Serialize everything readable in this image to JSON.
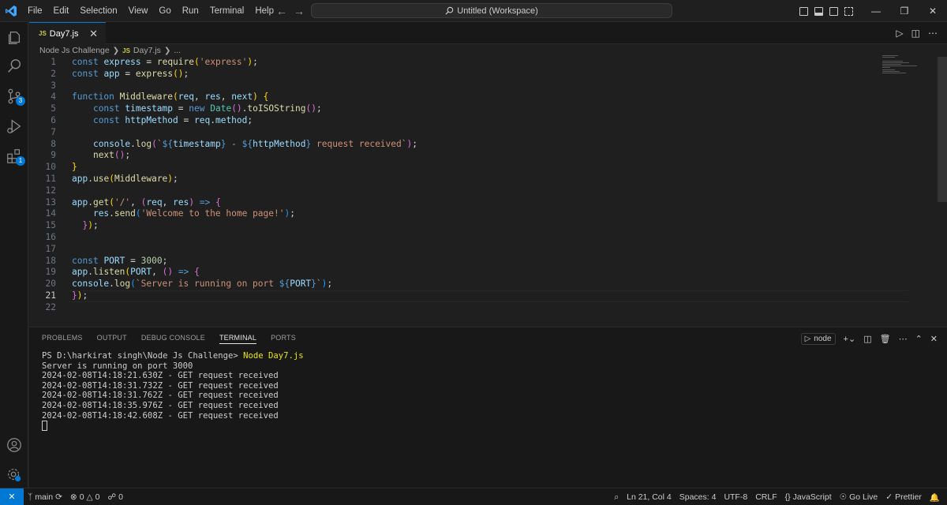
{
  "menu": [
    "File",
    "Edit",
    "Selection",
    "View",
    "Go",
    "Run",
    "Terminal",
    "Help"
  ],
  "command_center": {
    "label": "Untitled (Workspace)"
  },
  "tab": {
    "label": "Day7.js",
    "lang_badge": "JS"
  },
  "breadcrumb": {
    "folder": "Node Js Challenge",
    "file": "Day7.js",
    "more": "..."
  },
  "activity": {
    "scm_badge": "3",
    "ext_badge": "1"
  },
  "code_lines": [
    "1",
    "2",
    "3",
    "4",
    "5",
    "6",
    "7",
    "8",
    "9",
    "10",
    "11",
    "12",
    "13",
    "14",
    "15",
    "16",
    "17",
    "18",
    "19",
    "20",
    "21",
    "22"
  ],
  "panel": {
    "tabs": [
      "PROBLEMS",
      "OUTPUT",
      "DEBUG CONSOLE",
      "TERMINAL",
      "PORTS"
    ],
    "terminal_name": "node",
    "prompt": "PS D:\\harkirat singh\\Node Js Challenge> ",
    "command": "Node Day7.js",
    "output": [
      "Server is running on port 3000",
      "2024-02-08T14:18:21.630Z - GET request received",
      "2024-02-08T14:18:31.732Z - GET request received",
      "2024-02-08T14:18:31.762Z - GET request received",
      "2024-02-08T14:18:35.976Z - GET request received",
      "2024-02-08T14:18:42.608Z - GET request received"
    ]
  },
  "status": {
    "branch": "main",
    "errors": "0",
    "warnings": "0",
    "ports": "0",
    "position": "Ln 21, Col 4",
    "spaces": "Spaces: 4",
    "encoding": "UTF-8",
    "eol": "CRLF",
    "language": "JavaScript",
    "go_live": "Go Live",
    "prettier": "Prettier"
  }
}
